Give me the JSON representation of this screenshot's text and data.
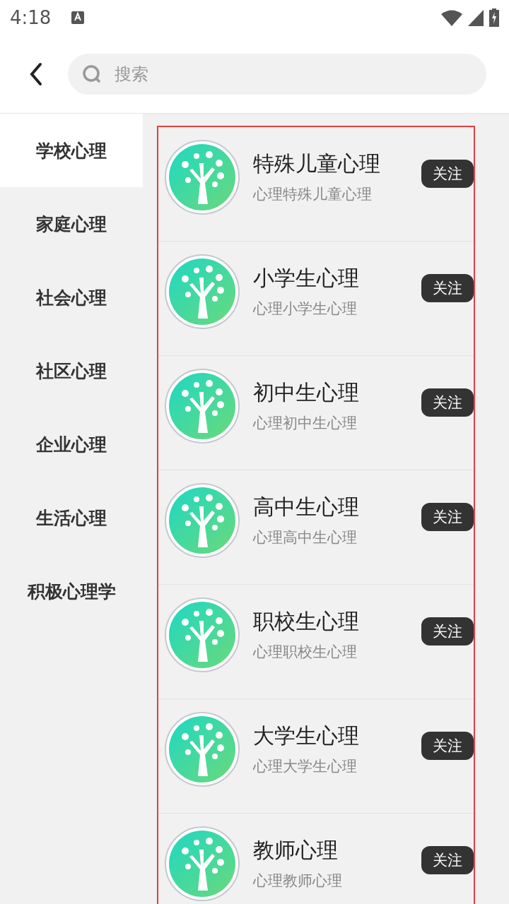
{
  "status_bar": {
    "time": "4:18"
  },
  "search": {
    "placeholder": "搜索"
  },
  "sidebar": {
    "items": [
      {
        "label": "学校心理",
        "selected": true
      },
      {
        "label": "家庭心理",
        "selected": false
      },
      {
        "label": "社会心理",
        "selected": false
      },
      {
        "label": "社区心理",
        "selected": false
      },
      {
        "label": "企业心理",
        "selected": false
      },
      {
        "label": "生活心理",
        "selected": false
      },
      {
        "label": "积极心理学",
        "selected": false
      }
    ]
  },
  "list": {
    "highlighted": true,
    "items": [
      {
        "title": "特殊儿童心理",
        "subtitle": "心理特殊儿童心理",
        "button": "关注"
      },
      {
        "title": "小学生心理",
        "subtitle": "心理小学生心理",
        "button": "关注"
      },
      {
        "title": "初中生心理",
        "subtitle": "心理初中生心理",
        "button": "关注"
      },
      {
        "title": "高中生心理",
        "subtitle": "心理高中生心理",
        "button": "关注"
      },
      {
        "title": "职校生心理",
        "subtitle": "心理职校生心理",
        "button": "关注"
      },
      {
        "title": "大学生心理",
        "subtitle": "心理大学生心理",
        "button": "关注"
      },
      {
        "title": "教师心理",
        "subtitle": "心理教师心理",
        "button": "关注"
      }
    ]
  }
}
